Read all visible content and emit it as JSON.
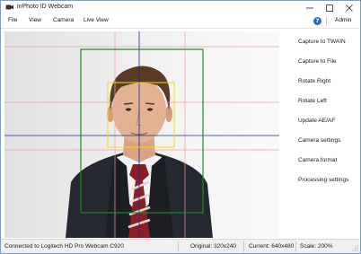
{
  "window": {
    "title": "inPhoto ID Webcam"
  },
  "menu": {
    "file": "File",
    "view": "View",
    "camera": "Camera",
    "live_view": "Live View",
    "help_glyph": "?",
    "admin": "Admin"
  },
  "side_panel": {
    "buttons": [
      "Capture to TWAIN",
      "Capture to File",
      "Rotate Right",
      "Rotate Left",
      "Update AE/AF",
      "Camera settings",
      "Camera format",
      "Processing settings"
    ]
  },
  "status": {
    "connection": "Connected to Logitech HD Pro Webcam C920",
    "original": "Original: 320x240",
    "current": "Current: 640x480",
    "scale": "Scale: 200%"
  },
  "overlay_colors": {
    "crop_frame": "#1e8a1e",
    "face_box": "#f0e000",
    "center_line": "#1c2c8c",
    "guide_line": "#e8a0a8"
  },
  "icons": {
    "app": "webcam-icon",
    "help": "help-icon",
    "minimize": "minimize-icon",
    "maximize": "maximize-icon",
    "close": "close-icon"
  }
}
